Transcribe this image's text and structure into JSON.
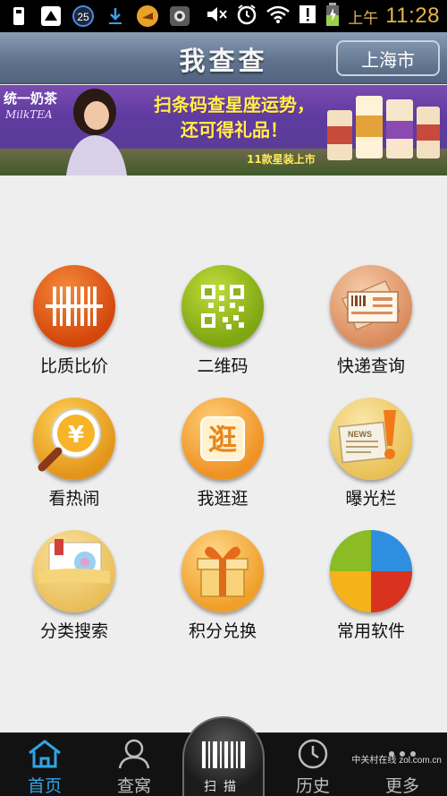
{
  "status_bar": {
    "badge": "25",
    "ampm": "上午",
    "time": "11:28",
    "icons": [
      "sim-icon",
      "app-icon",
      "badge-icon",
      "download-icon",
      "alarm-app-icon",
      "shield-icon",
      "mute-icon",
      "alarm-icon",
      "wifi-icon",
      "alert-icon",
      "battery-icon"
    ]
  },
  "header": {
    "title": "我查查",
    "city_button": "上海市"
  },
  "banner": {
    "brand": "统一奶茶",
    "brand_en": "MilkTEA",
    "headline_line1": "扫条码查星座运势，",
    "headline_line2": "还可得礼品！",
    "footer": "11款星装上市"
  },
  "grid": {
    "items": [
      {
        "label": "比质比价",
        "icon": "barcode-icon",
        "color": "#e35f12"
      },
      {
        "label": "二维码",
        "icon": "qrcode-icon",
        "color": "#8fb21a"
      },
      {
        "label": "快递查询",
        "icon": "package-icon",
        "color": "#e3a278"
      },
      {
        "label": "看热闹",
        "icon": "magnifier-yuan-icon",
        "color": "#f0a21a"
      },
      {
        "label": "我逛逛",
        "icon": "stroll-icon",
        "color": "#f4a436"
      },
      {
        "label": "曝光栏",
        "icon": "news-alert-icon",
        "color": "#f1cf69"
      },
      {
        "label": "分类搜索",
        "icon": "folder-icon",
        "color": "#f0cf69"
      },
      {
        "label": "积分兑换",
        "icon": "gift-icon",
        "color": "#f4ad33"
      },
      {
        "label": "常用软件",
        "icon": "pie-apps-icon",
        "color": "#2e8fe0"
      }
    ]
  },
  "bottom_nav": {
    "items": [
      {
        "label": "首页",
        "icon": "home-icon"
      },
      {
        "label": "查窝",
        "icon": "user-icon"
      },
      {
        "label": "历史",
        "icon": "clock-icon"
      },
      {
        "label": "更多",
        "icon": "more-icon"
      }
    ],
    "scan_label": "扫描",
    "active_color": "#2ea6e6"
  },
  "watermark": "中关村在线 zol.com.cn"
}
